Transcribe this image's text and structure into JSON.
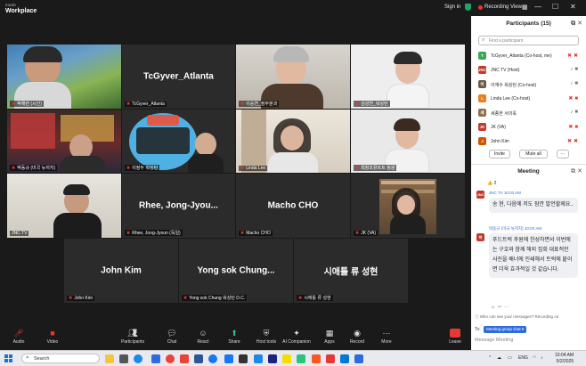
{
  "window": {
    "brand_top": "zoom",
    "brand_bottom": "Workplace",
    "sign_in": "Sign in",
    "recording": "Recording",
    "view": "View"
  },
  "tiles": [
    {
      "name": "박해련 (시인)",
      "big": ""
    },
    {
      "name": "TcGyver_Atlanta",
      "big": "TcGyver_Atlanta"
    },
    {
      "name": "이승연_정부분과",
      "big": ""
    },
    {
      "name": "김성연_워싱턴",
      "big": ""
    },
    {
      "name": "박동규 (미국 뉴저지)",
      "big": ""
    },
    {
      "name": "이정두 워싱턴",
      "big": ""
    },
    {
      "name": "Linda Lee",
      "big": ""
    },
    {
      "name": "최창조뮤트트 정광",
      "big": ""
    },
    {
      "name": "JNC TV",
      "big": ""
    },
    {
      "name": "Rhee, Jong-Jyoun (독일)",
      "big": "Rhee,  Jong-Jyou..."
    },
    {
      "name": "Macho CHO",
      "big": "Macho CHO"
    },
    {
      "name": "JK (VA)",
      "big": ""
    },
    {
      "name": "John Kim",
      "big": "John Kim"
    },
    {
      "name": "Yong sok Chung 워싱턴 D.C.",
      "big": "Yong sok Chung..."
    },
    {
      "name": "시애틀 류 성현",
      "big": "시애틀 류 성현"
    }
  ],
  "toolbar": {
    "audio": "Audio",
    "video": "Video",
    "participants": "Participants",
    "participants_count": "15",
    "chat": "Chat",
    "react": "React",
    "share": "Share",
    "host_tools": "Host tools",
    "ai_companion": "AI Companion",
    "apps": "Apps",
    "record": "Record",
    "more": "More",
    "leave": "Leave"
  },
  "participants_panel": {
    "title": "Participants (15)",
    "search_placeholder": "Find a participant",
    "invite": "Invite",
    "mute_all": "Mute all",
    "more": "···",
    "list": [
      {
        "initial": "T",
        "name": "TcGyver_Atlanta (Co-host, me)",
        "color": "#3aa757"
      },
      {
        "initial": "JNC",
        "name": "JNC TV (Host)",
        "color": "#c0392b"
      },
      {
        "initial": "이",
        "name": "이재수 워싱턴 (Co-host)",
        "color": "#6c5b4b"
      },
      {
        "initial": "L",
        "name": "Linda Lee (Co-host)",
        "color": "#e67e22"
      },
      {
        "initial": "세",
        "name": "세종한 서의욱",
        "color": "#8e6c4a"
      },
      {
        "initial": "JK",
        "name": "JK (VA)",
        "color": "#c0392b"
      },
      {
        "initial": "J",
        "name": "John Kim",
        "color": "#d35400"
      }
    ]
  },
  "chat": {
    "title": "Meeting",
    "reaction": "👍 2",
    "messages": [
      {
        "initial": "JNC",
        "sender": "JNC TV  10:03 AM",
        "text": "송 현, 다음에 저도 잠깐 발언할께요.."
      },
      {
        "initial": "박",
        "sender": "박동규 (미국 뉴저지)  10:03 AM",
        "text": "푸드트럭 후원에 찬성하면서 이번에는 구호와 함께 해외 집회 대표적인 사진을 배너에 인쇄해서 트럭에 붙이면 더욱 효과적일 것 같습니다."
      }
    ],
    "who_can_see": "Who can see your messages? Recording on",
    "to_label": "To:",
    "to_value": "Meeting group chat",
    "input_placeholder": "Message Meeting"
  },
  "taskbar": {
    "search_placeholder": "Search",
    "lang": "ENG",
    "time": "10:04 AM",
    "date": "5/2/2025"
  }
}
